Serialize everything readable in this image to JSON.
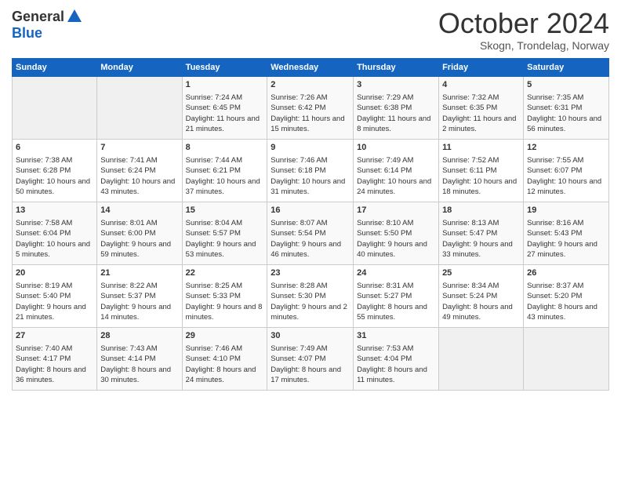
{
  "logo": {
    "general": "General",
    "blue": "Blue"
  },
  "header": {
    "month": "October 2024",
    "location": "Skogn, Trondelag, Norway"
  },
  "weekdays": [
    "Sunday",
    "Monday",
    "Tuesday",
    "Wednesday",
    "Thursday",
    "Friday",
    "Saturday"
  ],
  "weeks": [
    [
      {
        "day": "",
        "content": ""
      },
      {
        "day": "",
        "content": ""
      },
      {
        "day": "1",
        "content": "Sunrise: 7:24 AM\nSunset: 6:45 PM\nDaylight: 11 hours and 21 minutes."
      },
      {
        "day": "2",
        "content": "Sunrise: 7:26 AM\nSunset: 6:42 PM\nDaylight: 11 hours and 15 minutes."
      },
      {
        "day": "3",
        "content": "Sunrise: 7:29 AM\nSunset: 6:38 PM\nDaylight: 11 hours and 8 minutes."
      },
      {
        "day": "4",
        "content": "Sunrise: 7:32 AM\nSunset: 6:35 PM\nDaylight: 11 hours and 2 minutes."
      },
      {
        "day": "5",
        "content": "Sunrise: 7:35 AM\nSunset: 6:31 PM\nDaylight: 10 hours and 56 minutes."
      }
    ],
    [
      {
        "day": "6",
        "content": "Sunrise: 7:38 AM\nSunset: 6:28 PM\nDaylight: 10 hours and 50 minutes."
      },
      {
        "day": "7",
        "content": "Sunrise: 7:41 AM\nSunset: 6:24 PM\nDaylight: 10 hours and 43 minutes."
      },
      {
        "day": "8",
        "content": "Sunrise: 7:44 AM\nSunset: 6:21 PM\nDaylight: 10 hours and 37 minutes."
      },
      {
        "day": "9",
        "content": "Sunrise: 7:46 AM\nSunset: 6:18 PM\nDaylight: 10 hours and 31 minutes."
      },
      {
        "day": "10",
        "content": "Sunrise: 7:49 AM\nSunset: 6:14 PM\nDaylight: 10 hours and 24 minutes."
      },
      {
        "day": "11",
        "content": "Sunrise: 7:52 AM\nSunset: 6:11 PM\nDaylight: 10 hours and 18 minutes."
      },
      {
        "day": "12",
        "content": "Sunrise: 7:55 AM\nSunset: 6:07 PM\nDaylight: 10 hours and 12 minutes."
      }
    ],
    [
      {
        "day": "13",
        "content": "Sunrise: 7:58 AM\nSunset: 6:04 PM\nDaylight: 10 hours and 5 minutes."
      },
      {
        "day": "14",
        "content": "Sunrise: 8:01 AM\nSunset: 6:00 PM\nDaylight: 9 hours and 59 minutes."
      },
      {
        "day": "15",
        "content": "Sunrise: 8:04 AM\nSunset: 5:57 PM\nDaylight: 9 hours and 53 minutes."
      },
      {
        "day": "16",
        "content": "Sunrise: 8:07 AM\nSunset: 5:54 PM\nDaylight: 9 hours and 46 minutes."
      },
      {
        "day": "17",
        "content": "Sunrise: 8:10 AM\nSunset: 5:50 PM\nDaylight: 9 hours and 40 minutes."
      },
      {
        "day": "18",
        "content": "Sunrise: 8:13 AM\nSunset: 5:47 PM\nDaylight: 9 hours and 33 minutes."
      },
      {
        "day": "19",
        "content": "Sunrise: 8:16 AM\nSunset: 5:43 PM\nDaylight: 9 hours and 27 minutes."
      }
    ],
    [
      {
        "day": "20",
        "content": "Sunrise: 8:19 AM\nSunset: 5:40 PM\nDaylight: 9 hours and 21 minutes."
      },
      {
        "day": "21",
        "content": "Sunrise: 8:22 AM\nSunset: 5:37 PM\nDaylight: 9 hours and 14 minutes."
      },
      {
        "day": "22",
        "content": "Sunrise: 8:25 AM\nSunset: 5:33 PM\nDaylight: 9 hours and 8 minutes."
      },
      {
        "day": "23",
        "content": "Sunrise: 8:28 AM\nSunset: 5:30 PM\nDaylight: 9 hours and 2 minutes."
      },
      {
        "day": "24",
        "content": "Sunrise: 8:31 AM\nSunset: 5:27 PM\nDaylight: 8 hours and 55 minutes."
      },
      {
        "day": "25",
        "content": "Sunrise: 8:34 AM\nSunset: 5:24 PM\nDaylight: 8 hours and 49 minutes."
      },
      {
        "day": "26",
        "content": "Sunrise: 8:37 AM\nSunset: 5:20 PM\nDaylight: 8 hours and 43 minutes."
      }
    ],
    [
      {
        "day": "27",
        "content": "Sunrise: 7:40 AM\nSunset: 4:17 PM\nDaylight: 8 hours and 36 minutes."
      },
      {
        "day": "28",
        "content": "Sunrise: 7:43 AM\nSunset: 4:14 PM\nDaylight: 8 hours and 30 minutes."
      },
      {
        "day": "29",
        "content": "Sunrise: 7:46 AM\nSunset: 4:10 PM\nDaylight: 8 hours and 24 minutes."
      },
      {
        "day": "30",
        "content": "Sunrise: 7:49 AM\nSunset: 4:07 PM\nDaylight: 8 hours and 17 minutes."
      },
      {
        "day": "31",
        "content": "Sunrise: 7:53 AM\nSunset: 4:04 PM\nDaylight: 8 hours and 11 minutes."
      },
      {
        "day": "",
        "content": ""
      },
      {
        "day": "",
        "content": ""
      }
    ]
  ]
}
